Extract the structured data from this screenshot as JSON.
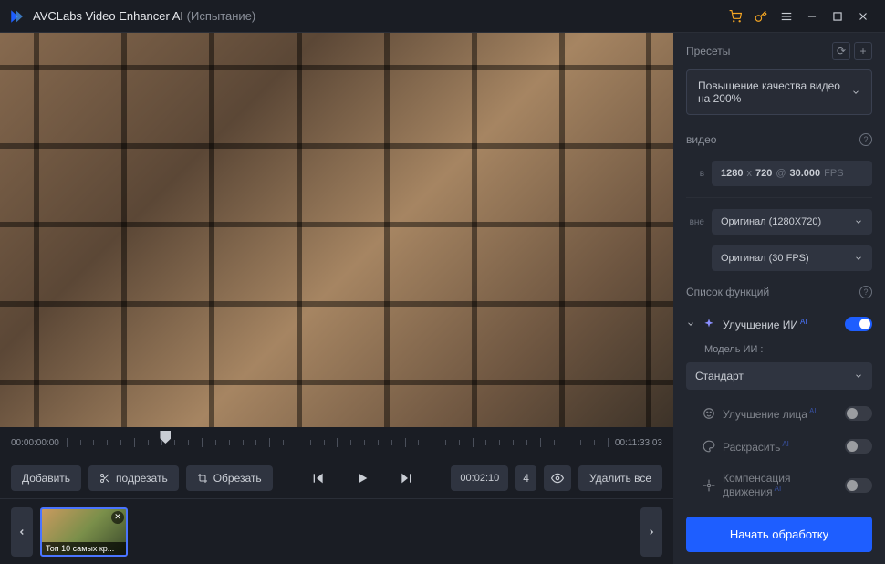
{
  "titlebar": {
    "app_name": "AVCLabs Video Enhancer AI",
    "trial": "(Испытание)"
  },
  "timeline": {
    "start_time": "00:00:00:00",
    "end_time": "00:11:33:03",
    "playhead_percent": 17.3
  },
  "controls": {
    "add": "Добавить",
    "trim": "подрезать",
    "crop": "Обрезать",
    "current_time": "00:02:10",
    "speed": "4",
    "delete_all": "Удалить все"
  },
  "thumbs": [
    {
      "label": "Топ 10 самых кр..."
    }
  ],
  "side": {
    "presets_header": "Пресеты",
    "preset_selected": "Повышение качества видео на 200%",
    "video_header": "видео",
    "video_in_label": "в",
    "video_in_w": "1280",
    "video_in_h": "720",
    "video_in_at": "@",
    "video_in_fps": "30.000",
    "video_in_fps_unit": "FPS",
    "video_out_label": "вне",
    "resolution_selected": "Оригинал (1280X720)",
    "fps_selected": "Оригинал (30 FPS)",
    "functions_header": "Список функций",
    "enhance_ai": "Улучшение ИИ",
    "model_label": "Модель ИИ :",
    "model_selected": "Стандарт",
    "face_enhance": "Улучшение лица",
    "colorize": "Раскрасить",
    "motion_comp": "Компенсация движения",
    "ai_sup": "AI",
    "start": "Начать обработку"
  }
}
